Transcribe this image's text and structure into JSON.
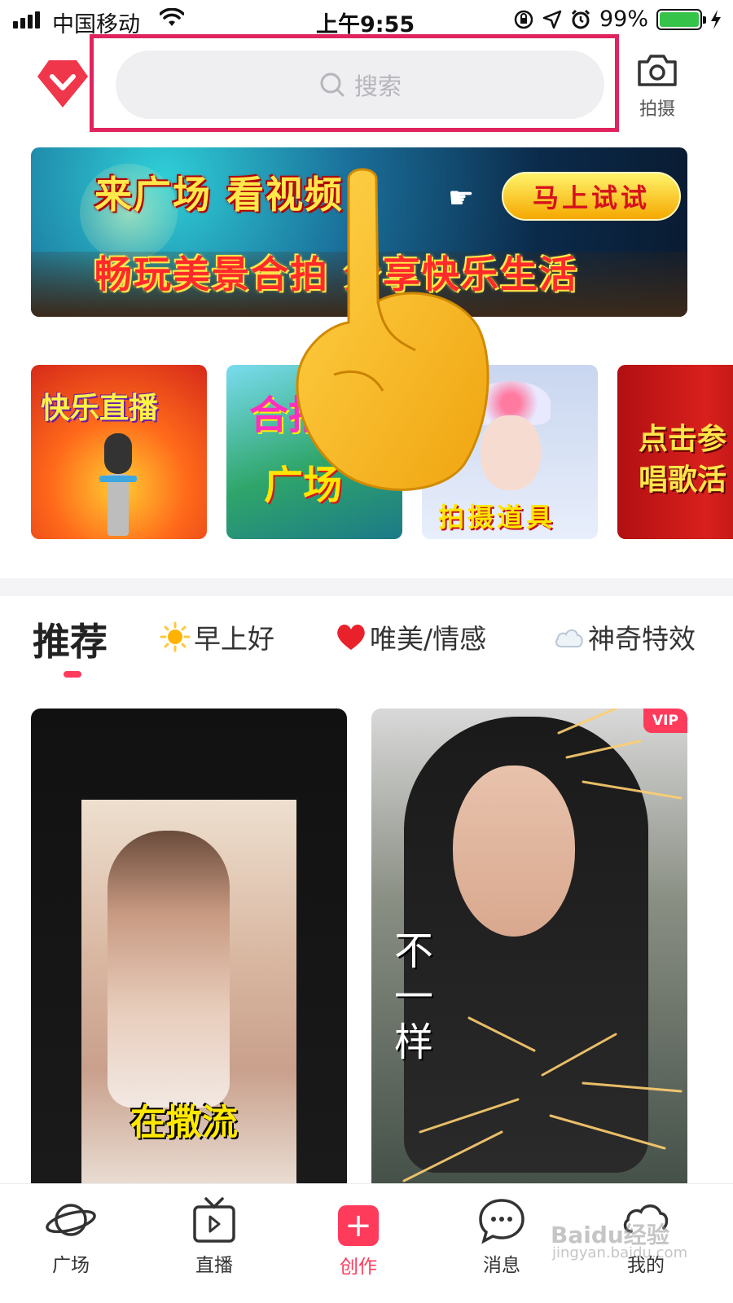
{
  "status_bar": {
    "carrier": "中国移动",
    "time": "上午9:55",
    "battery_text": "99%",
    "battery_level": 0.99,
    "battery_color": "#36c34a"
  },
  "header": {
    "logo_icon": "heart-diamond-logo-icon",
    "search_placeholder": "搜索",
    "camera_label": "拍摄",
    "highlight_color": "#e0245e"
  },
  "banner": {
    "line1": "来广场 看视频",
    "line2": "畅玩美景合拍 分享快乐生活",
    "cta": "马上试试"
  },
  "cards": [
    {
      "title": "快乐直播"
    },
    {
      "title_top": "合拍",
      "title_bottom": "广场"
    },
    {
      "title": "拍摄道具"
    },
    {
      "title_top": "点击参",
      "title_bottom": "唱歌活"
    }
  ],
  "tabs": [
    {
      "label": "推荐",
      "active": true
    },
    {
      "label": "早上好",
      "icon": "sun-icon"
    },
    {
      "label": "唯美/情感",
      "icon": "heart-icon"
    },
    {
      "label": "神奇特效",
      "icon": "cloud-icon"
    }
  ],
  "feed": [
    {
      "caption": "在撒流"
    },
    {
      "caption": "不一样",
      "badge": "VIP"
    }
  ],
  "bottom_nav": [
    {
      "label": "广场",
      "icon": "planet-icon"
    },
    {
      "label": "直播",
      "icon": "tv-icon"
    },
    {
      "label": "创作",
      "icon": "plus-icon",
      "active": true
    },
    {
      "label": "消息",
      "icon": "chat-bubble-icon"
    },
    {
      "label": "我的",
      "icon": "profile-icon"
    }
  ],
  "watermark": {
    "text": "Baidu经验",
    "url": "jingyan.baidu.com"
  },
  "accent_color": "#ff3b5c"
}
